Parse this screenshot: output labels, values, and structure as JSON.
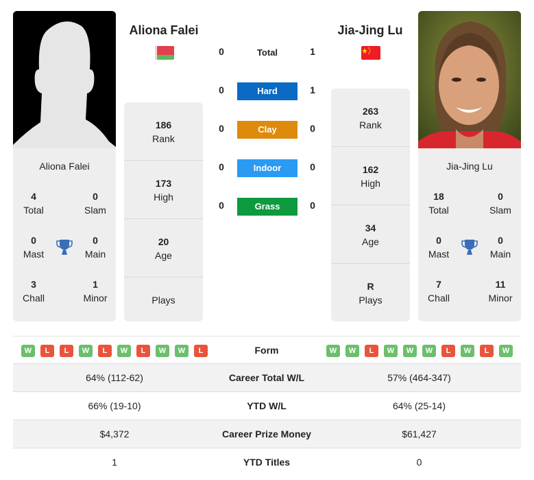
{
  "player1": {
    "name": "Aliona Falei",
    "country": "Belarus",
    "flag_colors": {
      "top": "#e33f4c",
      "bottom": "#5cb85c",
      "hoist": "#ffffff"
    },
    "titles": {
      "total": {
        "value": "4",
        "label": "Total"
      },
      "slam": {
        "value": "0",
        "label": "Slam"
      },
      "mast": {
        "value": "0",
        "label": "Mast"
      },
      "main": {
        "value": "0",
        "label": "Main"
      },
      "chall": {
        "value": "3",
        "label": "Chall"
      },
      "minor": {
        "value": "1",
        "label": "Minor"
      }
    },
    "stats": {
      "rank": {
        "value": "186",
        "label": "Rank"
      },
      "high": {
        "value": "173",
        "label": "High"
      },
      "age": {
        "value": "20",
        "label": "Age"
      },
      "plays": {
        "value": "",
        "label": "Plays"
      }
    },
    "form": [
      "W",
      "L",
      "L",
      "W",
      "L",
      "W",
      "L",
      "W",
      "W",
      "L"
    ]
  },
  "player2": {
    "name": "Jia-Jing Lu",
    "country": "China",
    "flag_colors": {
      "field": "#ee1c25",
      "star": "#ffde00"
    },
    "titles": {
      "total": {
        "value": "18",
        "label": "Total"
      },
      "slam": {
        "value": "0",
        "label": "Slam"
      },
      "mast": {
        "value": "0",
        "label": "Mast"
      },
      "main": {
        "value": "0",
        "label": "Main"
      },
      "chall": {
        "value": "7",
        "label": "Chall"
      },
      "minor": {
        "value": "11",
        "label": "Minor"
      }
    },
    "stats": {
      "rank": {
        "value": "263",
        "label": "Rank"
      },
      "high": {
        "value": "162",
        "label": "High"
      },
      "age": {
        "value": "34",
        "label": "Age"
      },
      "plays": {
        "value": "R",
        "label": "Plays"
      }
    },
    "form": [
      "W",
      "W",
      "L",
      "W",
      "W",
      "W",
      "L",
      "W",
      "L",
      "W"
    ]
  },
  "h2h": {
    "total": {
      "label": "Total",
      "p1": "0",
      "p2": "1"
    },
    "surfaces": [
      {
        "label": "Hard",
        "p1": "0",
        "p2": "1",
        "color": "#0a6ac4"
      },
      {
        "label": "Clay",
        "p1": "0",
        "p2": "0",
        "color": "#de8a0c"
      },
      {
        "label": "Indoor",
        "p1": "0",
        "p2": "0",
        "color": "#2b9af3"
      },
      {
        "label": "Grass",
        "p1": "0",
        "p2": "0",
        "color": "#0e9a3e"
      }
    ]
  },
  "comparison": {
    "form_label": "Form",
    "rows": [
      {
        "label": "Career Total W/L",
        "p1": "64% (112-62)",
        "p2": "57% (464-347)"
      },
      {
        "label": "YTD W/L",
        "p1": "66% (19-10)",
        "p2": "64% (25-14)"
      },
      {
        "label": "Career Prize Money",
        "p1": "$4,372",
        "p2": "$61,427"
      },
      {
        "label": "YTD Titles",
        "p1": "1",
        "p2": "0"
      }
    ]
  },
  "colors": {
    "win": "#6cbf6c",
    "loss": "#e8553d",
    "trophy": "#3a6db8",
    "card_bg": "#eeeeee"
  }
}
